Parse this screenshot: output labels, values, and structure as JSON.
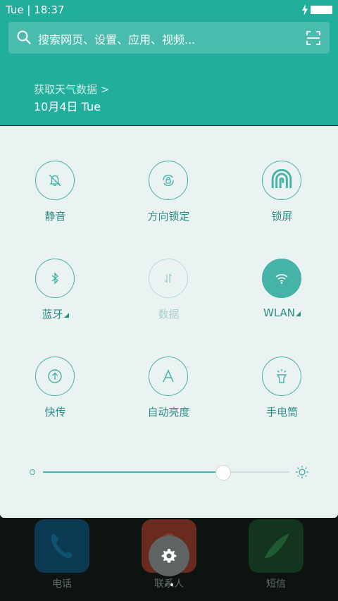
{
  "status_bar": {
    "time": "Tue | 18:37",
    "charge_icon": "bolt-icon",
    "battery_icon": "battery-icon"
  },
  "search": {
    "placeholder": "搜索网页、设置、应用、视频...",
    "left_icon": "search-icon",
    "right_icon": "scan-icon"
  },
  "weather": {
    "link_text": "获取天气数据 >",
    "date": "10月4日 Tue"
  },
  "toggles": [
    {
      "label": "静音",
      "icon": "bell-off-icon"
    },
    {
      "label": "方向锁定",
      "icon": "rotation-lock-icon"
    },
    {
      "label": "锁屏",
      "icon": "fingerprint-icon"
    },
    {
      "label": "蓝牙",
      "icon": "bluetooth-icon"
    },
    {
      "label": "数据",
      "icon": "mobile-data-icon"
    },
    {
      "label": "WLAN",
      "icon": "wifi-icon"
    },
    {
      "label": "快传",
      "icon": "share-transfer-icon"
    },
    {
      "label": "自动亮度",
      "icon": "auto-brightness-icon"
    },
    {
      "label": "手电筒",
      "icon": "flashlight-icon"
    }
  ],
  "brightness": {
    "level": 0.73,
    "low_icon": "brightness-low-icon",
    "high_icon": "brightness-high-icon"
  },
  "dock": [
    {
      "label": "电话",
      "icon": "phone-icon",
      "color": "#0b3a52"
    },
    {
      "label": "联系人",
      "icon": "contacts-icon",
      "color": "#6a2b1f"
    },
    {
      "label": "短信",
      "icon": "message-icon",
      "color": "#13351f"
    }
  ],
  "settings": {
    "icon": "gear-icon"
  },
  "colors": {
    "accent": "#21ae9c",
    "toggle": "#45b3a6",
    "panel": "#eaf2f2"
  }
}
